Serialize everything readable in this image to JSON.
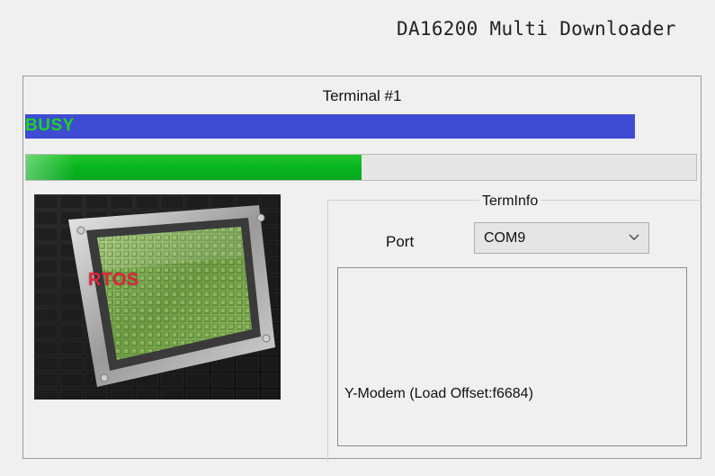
{
  "window": {
    "title": "DA16200 Multi Downloader"
  },
  "terminal": {
    "title": "Terminal #1",
    "status": {
      "text": "BUSY",
      "bar_color": "#3f4bd3",
      "text_color": "#1ed51e"
    },
    "progress": {
      "fraction": 0.5,
      "fill_color": "#07b51f"
    },
    "image": {
      "label": "RTOS",
      "label_color": "#e0243a",
      "subject": "chip-image"
    }
  },
  "terminfo": {
    "title": "TermInfo",
    "port_label": "Port",
    "port_selected": "COM9",
    "info_text": "Y-Modem (Load Offset:f6684)"
  },
  "icons": {
    "dropdown": "chevron-down-icon"
  }
}
